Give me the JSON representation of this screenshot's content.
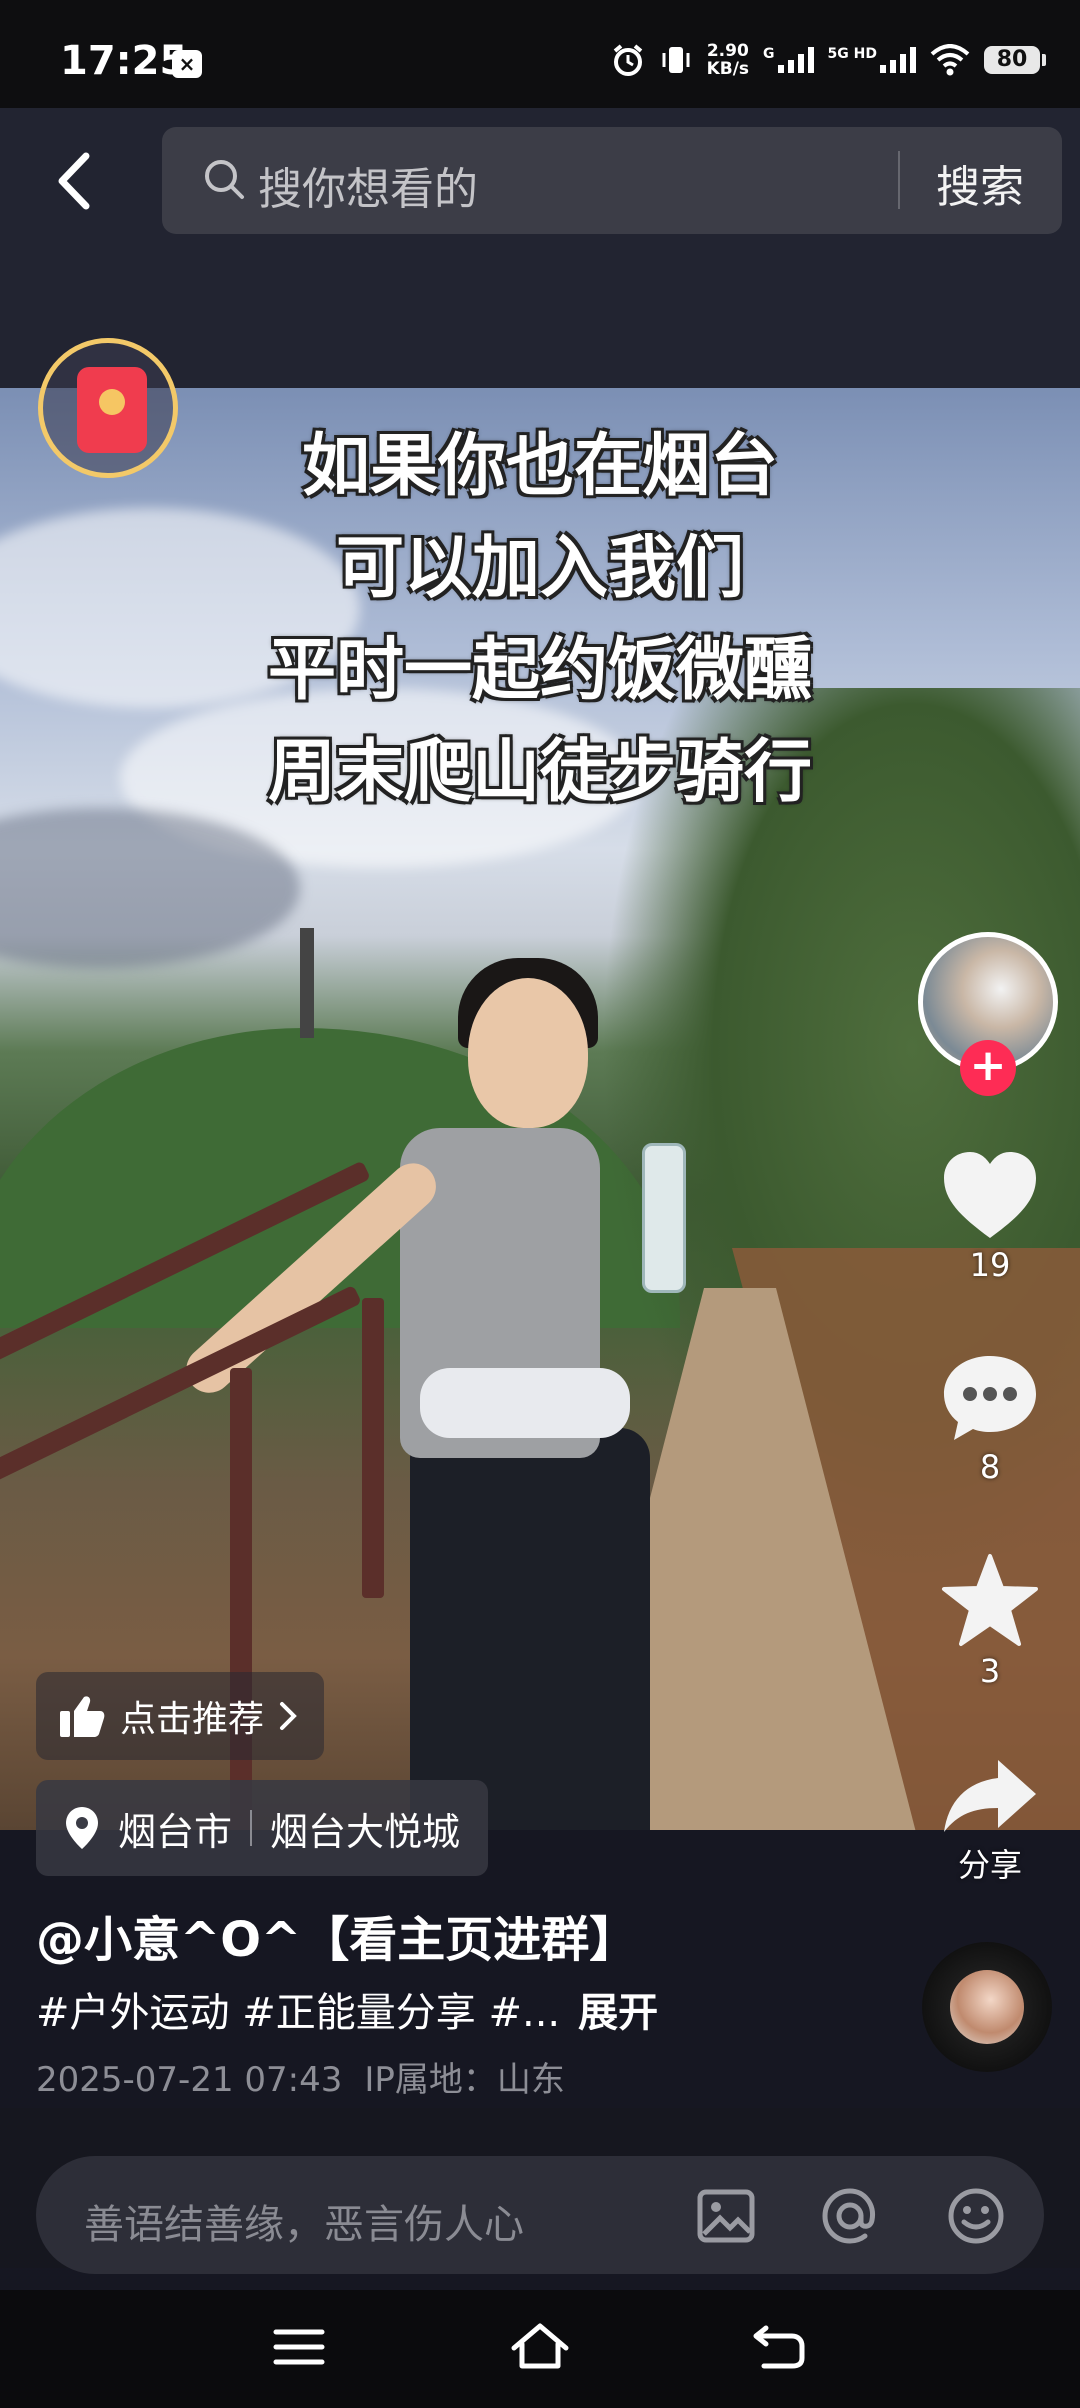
{
  "status_bar": {
    "time": "17:25",
    "app_badge": "×",
    "net_speed_value": "2.90",
    "net_speed_unit": "KB/s",
    "sim1_label": "G",
    "sim2_label": "5G HD",
    "battery": "80"
  },
  "search": {
    "placeholder": "搜你想看的",
    "button_label": "搜索"
  },
  "video": {
    "overlay_lines": [
      "如果你也在烟台",
      "可以加入我们",
      "平时一起约饭微醺",
      "周末爬山徒步骑行"
    ]
  },
  "rail": {
    "likes": "19",
    "comments": "8",
    "favorites": "3",
    "share_label": "分享"
  },
  "recommend_chip": {
    "label": "点击推荐"
  },
  "location": {
    "city": "烟台市",
    "place": "烟台大悦城"
  },
  "post": {
    "author": "@小意^O^【看主页进群】",
    "tags": "#户外运动 #正能量分享 #...",
    "expand_label": "展开",
    "datetime": "2025-07-21 07:43",
    "ip_location": "IP属地：山东"
  },
  "comment": {
    "placeholder": "善语结善缘，恶言伤人心"
  },
  "icons": [
    "back-icon",
    "search-icon",
    "red-packet-icon",
    "heart-icon",
    "comment-icon",
    "star-icon",
    "share-icon",
    "thumbs-up-icon",
    "chevron-right-icon",
    "location-pin-icon",
    "image-icon",
    "at-icon",
    "emoji-icon",
    "menu-icon",
    "home-icon",
    "back-nav-icon"
  ],
  "colors": {
    "accent": "#fe2c55",
    "red_packet": "#f03c4e",
    "red_packet_ring": "#f3c969"
  }
}
